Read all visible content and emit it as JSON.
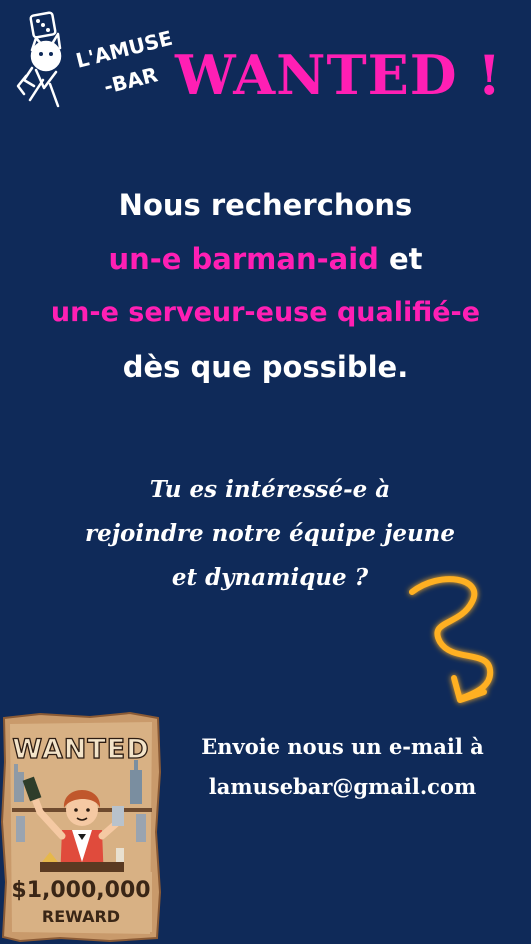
{
  "logo": {
    "line1": "L'AMUSE",
    "line2": "-BAR",
    "icon": "cat-mascot-with-dice-icon"
  },
  "title": "WANTED !",
  "headline": {
    "line1": "Nous recherchons",
    "line2_pink": "un-e barman-aid",
    "line2_white": " et",
    "line3": "un-e serveur-euse qualifié-e",
    "line4": "dès que possible."
  },
  "question": {
    "line1": "Tu es intéressé-e à",
    "line2": "rejoindre notre équipe jeune",
    "line3": "et dynamique ?"
  },
  "contact": {
    "line1": "Envoie nous  un e-mail à",
    "line2": "lamusebar@gmail.com"
  },
  "poster": {
    "heading": "WANTED",
    "amount": "$1,000,000",
    "reward": "REWARD",
    "icon": "bartender-illustration"
  },
  "colors": {
    "background": "#0f2a59",
    "accent_pink": "#ff1fb4",
    "arrow_orange": "#ffb020",
    "text": "#ffffff"
  }
}
